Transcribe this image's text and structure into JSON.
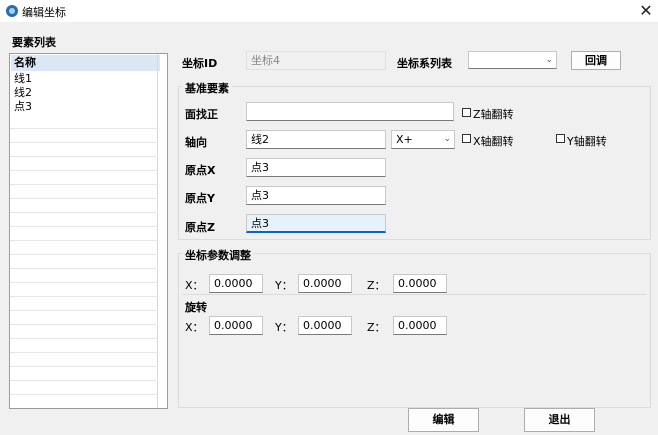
{
  "window": {
    "title": "编辑坐标",
    "close_glyph": "✕"
  },
  "list": {
    "caption": "要素列表",
    "header": "名称",
    "items": [
      "线1",
      "线2",
      "点3"
    ]
  },
  "top": {
    "id_label": "坐标ID",
    "id_value": "坐标4",
    "series_label": "坐标系列表",
    "series_value": "",
    "return_btn": "回调"
  },
  "base": {
    "caption": "基准要素",
    "face_label": "面找正",
    "face_value": "",
    "z_flip": "Z轴翻转",
    "axis_label": "轴向",
    "axis_value": "线2",
    "axis_dir": "X+",
    "x_flip": "X轴翻转",
    "y_flip": "Y轴翻转",
    "ox_label": "原点X",
    "ox_value": "点3",
    "oy_label": "原点Y",
    "oy_value": "点3",
    "oz_label": "原点Z",
    "oz_value": "点3"
  },
  "adjust": {
    "caption": "坐标参数调整",
    "x_label": "X：",
    "x_value": "0.0000",
    "y_label": "Y：",
    "y_value": "0.0000",
    "z_label": "Z：",
    "z_value": "0.0000",
    "rotate_caption": "旋转",
    "rx_label": "X：",
    "rx_value": "0.0000",
    "ry_label": "Y：",
    "ry_value": "0.0000",
    "rz_label": "Z：",
    "rz_value": "0.0000"
  },
  "buttons": {
    "edit": "编辑",
    "exit": "退出"
  },
  "icons": {
    "app": "app-icon",
    "close": "close-icon",
    "dropdown": "chevron-down-icon"
  }
}
